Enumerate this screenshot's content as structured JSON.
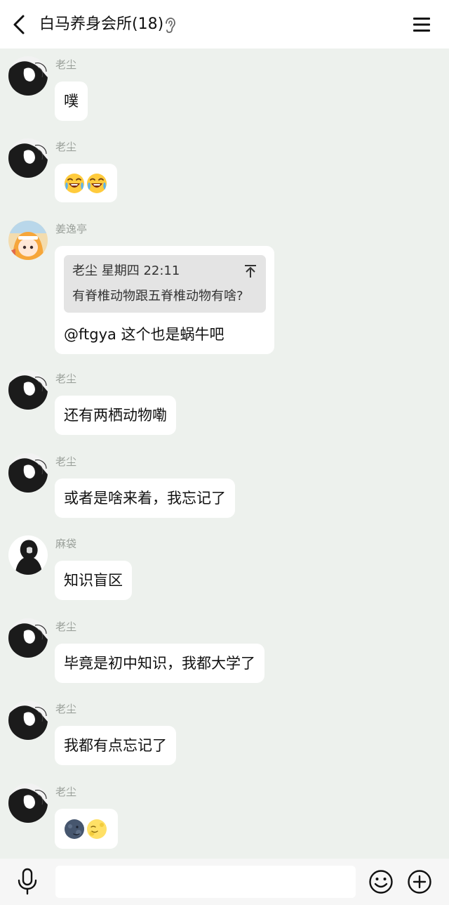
{
  "header": {
    "title": "白马养身会所(18)",
    "icons": {
      "back": "chevron-left-icon",
      "ear": "ear-icon",
      "menu": "hamburger-menu-icon"
    }
  },
  "messages": [
    {
      "sender": "老尘",
      "avatar": "black-white-manga-avatar",
      "text": "噗"
    },
    {
      "sender": "老尘",
      "avatar": "black-white-manga-avatar",
      "emoji": [
        "laugh-cry-emoji",
        "laugh-cry-emoji"
      ]
    },
    {
      "sender": "姜逸亭",
      "avatar": "colorful-anime-girl-avatar",
      "quote": {
        "meta": "老尘 星期四 22:11",
        "text": "有脊椎动物跟五脊椎动物有啥?"
      },
      "text": "@ftgya 这个也是蜗牛吧"
    },
    {
      "sender": "老尘",
      "avatar": "black-white-manga-avatar",
      "text": "还有两栖动物嘞"
    },
    {
      "sender": "老尘",
      "avatar": "black-white-manga-avatar",
      "text": "或者是啥来着，我忘记了"
    },
    {
      "sender": "麻袋",
      "avatar": "dark-silhouette-avatar",
      "text": "知识盲区"
    },
    {
      "sender": "老尘",
      "avatar": "black-white-manga-avatar",
      "text": "毕竟是初中知识，我都大学了"
    },
    {
      "sender": "老尘",
      "avatar": "black-white-manga-avatar",
      "text": "我都有点忘记了"
    },
    {
      "sender": "老尘",
      "avatar": "black-white-manga-avatar",
      "emoji": [
        "new-moon-face-emoji",
        "full-moon-face-emoji"
      ]
    }
  ],
  "input_bar": {
    "text_value": "",
    "icons": {
      "mic": "microphone-icon",
      "emoji": "smiley-icon",
      "more": "plus-circle-icon"
    }
  },
  "colors": {
    "background": "#edf1ed",
    "bubble": "#ffffff",
    "header": "#ffffff",
    "quote_bg": "#e4e4e4",
    "sender_name": "#9aa09a"
  }
}
